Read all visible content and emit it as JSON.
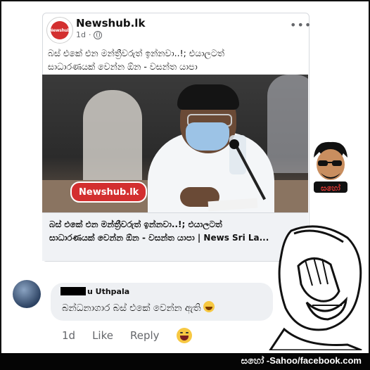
{
  "post": {
    "page_name": "Newshub.lk",
    "avatar_text": "Newshub",
    "time": "1d",
    "dot": "·",
    "more": "•••",
    "text_line1": "බස් එකේ එන මන්ත්‍රීවරුත් ඉන්නවා..!; එයාලටත්",
    "text_line2": "සාධාරණයක් වෙන්න ඕන - වසන්ත යාපා",
    "photo_watermark": "Newshub.lk",
    "link_title_line1": "බස් එකේ එන මන්ත්‍රීවරුත් ඉන්නවා..!; එයාලටත්",
    "link_title_line2": "සාධාරණයක් වෙන්න ඕන - වසන්ත යාපා | News Sri La..."
  },
  "comment": {
    "author": "u Uthpala",
    "text": "බන්ධනාගාර බස් එකේ වෙන්න ඇති",
    "time": "1d",
    "like": "Like",
    "reply": "Reply"
  },
  "branding": {
    "sticker_text": "සහෝ",
    "footer": "සහෝ -Sahoo/facebook.com"
  }
}
